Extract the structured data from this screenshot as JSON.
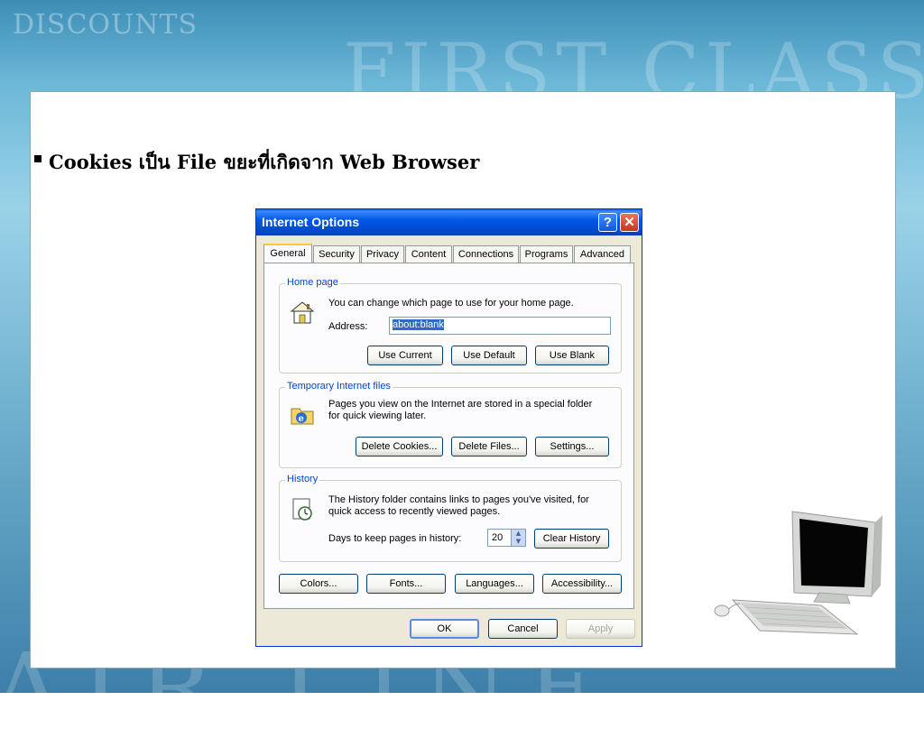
{
  "slide": {
    "bg_words": {
      "discounts": "DISCOUNTS",
      "first_class": "FIRST CLASS",
      "bottom": "AIR LINE"
    },
    "bullet_text": "Cookies  เป็น File ขยะที่เกิดจาก Web Browser"
  },
  "dialog": {
    "title": "Internet Options",
    "help_glyph": "?",
    "close_glyph": "✕",
    "tabs": [
      "General",
      "Security",
      "Privacy",
      "Content",
      "Connections",
      "Programs",
      "Advanced"
    ],
    "active_tab": "General",
    "home_page": {
      "label": "Home page",
      "description": "You can change which page to use for your home page.",
      "address_label": "Address:",
      "address_value": "about:blank",
      "buttons": [
        "Use Current",
        "Use Default",
        "Use Blank"
      ]
    },
    "temp_files": {
      "label": "Temporary Internet files",
      "description_line1": "Pages you view on the Internet are stored in a special folder",
      "description_line2": "for quick viewing later.",
      "buttons": [
        "Delete Cookies...",
        "Delete Files...",
        "Settings..."
      ]
    },
    "history": {
      "label": "History",
      "description_line1": "The History folder contains links to pages you've visited, for",
      "description_line2": "quick access to recently viewed pages.",
      "days_label": "Days to keep pages in history:",
      "days_value": "20",
      "clear_button": "Clear History"
    },
    "bottom_buttons": [
      "Colors...",
      "Fonts...",
      "Languages...",
      "Accessibility..."
    ],
    "footer_buttons": {
      "ok": "OK",
      "cancel": "Cancel",
      "apply": "Apply"
    }
  },
  "colors": {
    "title_bar": "#0058e6",
    "group_label": "#0046d5",
    "tab_highlight": "#ffc83c",
    "selection": "#316ac5"
  }
}
